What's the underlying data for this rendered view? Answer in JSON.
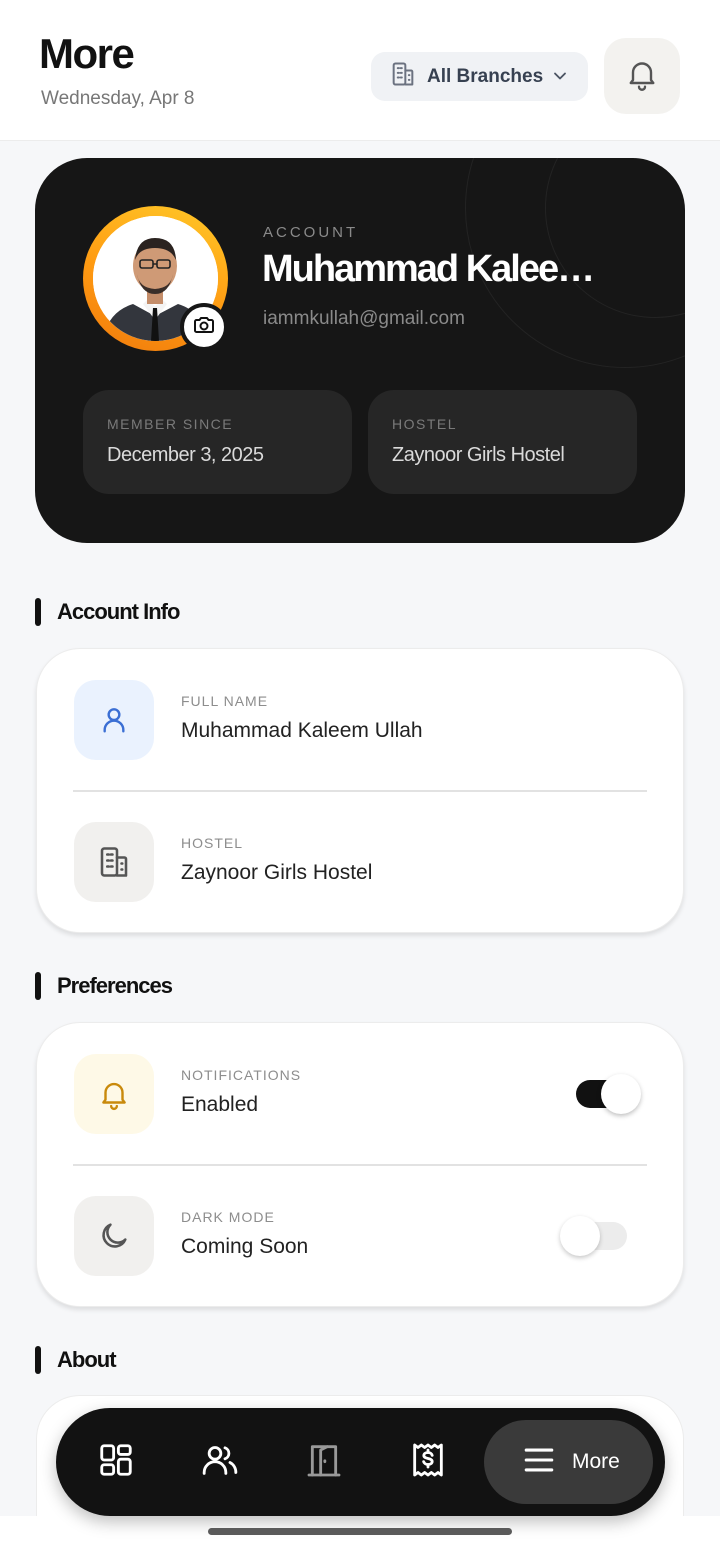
{
  "header": {
    "title": "More",
    "date": "Wednesday, Apr 8",
    "branch_selector": {
      "value": "All Branches",
      "icon": "building-icon"
    },
    "notifications_icon": "bell-icon"
  },
  "profile": {
    "kicker": "ACCOUNT",
    "name": "Muhammad Kaleem ...",
    "email": "iammkullah@gmail.com",
    "avatar_ring_colors": [
      "#ffc928",
      "#f07b0c"
    ],
    "camera_icon": "camera-icon",
    "stats": [
      {
        "label": "MEMBER SINCE",
        "value": "December 3, 2025"
      },
      {
        "label": "HOSTEL",
        "value": "Zaynoor Girls Hostel"
      }
    ]
  },
  "account_info": {
    "title": "Account Info",
    "rows": [
      {
        "label": "FULL NAME",
        "value": "Muhammad Kaleem Ullah",
        "icon": "user-icon",
        "tile_color": "#eaf2fe",
        "icon_color": "#3b6fd4"
      },
      {
        "label": "HOSTEL",
        "value": "Zaynoor Girls Hostel",
        "icon": "building-icon",
        "tile_color": "#f1f0ee",
        "icon_color": "#555555"
      }
    ]
  },
  "preferences": {
    "title": "Preferences",
    "rows": [
      {
        "label": "NOTIFICATIONS",
        "value": "Enabled",
        "icon": "bell-icon",
        "tile_color": "#fef9e7",
        "icon_color": "#c98a0c",
        "toggle_on": true
      },
      {
        "label": "DARK MODE",
        "value": "Coming Soon",
        "icon": "moon-icon",
        "tile_color": "#f1f0ee",
        "icon_color": "#555555",
        "toggle_on": false
      }
    ]
  },
  "about": {
    "title": "About"
  },
  "bottom_nav": {
    "items": [
      {
        "icon": "dashboard-icon"
      },
      {
        "icon": "users-icon"
      },
      {
        "icon": "door-icon"
      },
      {
        "icon": "receipt-dollar-icon"
      }
    ],
    "active": {
      "icon": "menu-icon",
      "label": "More"
    }
  },
  "colors": {
    "card_dark": "#161616",
    "background": "#f6f7f9",
    "accent": "#111111"
  }
}
